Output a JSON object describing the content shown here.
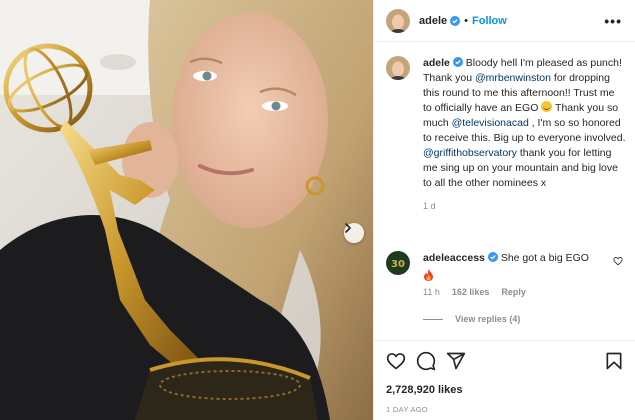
{
  "post": {
    "username": "adele",
    "follow_label": "Follow",
    "separator": "•",
    "more_label": "•••",
    "caption": {
      "username": "adele",
      "part1": "Bloody hell I'm pleased as punch! Thank you ",
      "mention1": "@mrbenwinston",
      "part2": " for dropping this round to me this afternoon!! Trust me to officially have an EGO ",
      "part3": " Thank you so much ",
      "mention2": "@televisionacad",
      "part4": " , I'm so so honored to receive this. Big up to everyone involved. ",
      "mention3": "@griffithobservatory",
      "part5": " thank you for letting me sing up on your mountain and big love to all the other nominees x",
      "time": "1 d"
    },
    "comment": {
      "username": "adeleaccess",
      "text": "She got a big EGO",
      "time": "11 h",
      "likes": "162 likes",
      "reply_label": "Reply",
      "view_replies": "View replies (4)"
    },
    "likes": "2,728,920 likes",
    "date": "1 DAY AGO"
  },
  "icons": {
    "header_avatar": "avatar",
    "verified": "verified-badge-icon",
    "next": "chevron-right-icon",
    "like": "heart-icon",
    "comment": "comment-icon",
    "share": "paper-plane-icon",
    "save": "bookmark-icon",
    "laughing_emoji": "rolling-laughing-emoji",
    "fire_emoji": "fire-emoji"
  },
  "colors": {
    "accent": "#0095f6",
    "link": "#00376b",
    "muted": "#8e8e8e",
    "verified": "#3897f0"
  }
}
